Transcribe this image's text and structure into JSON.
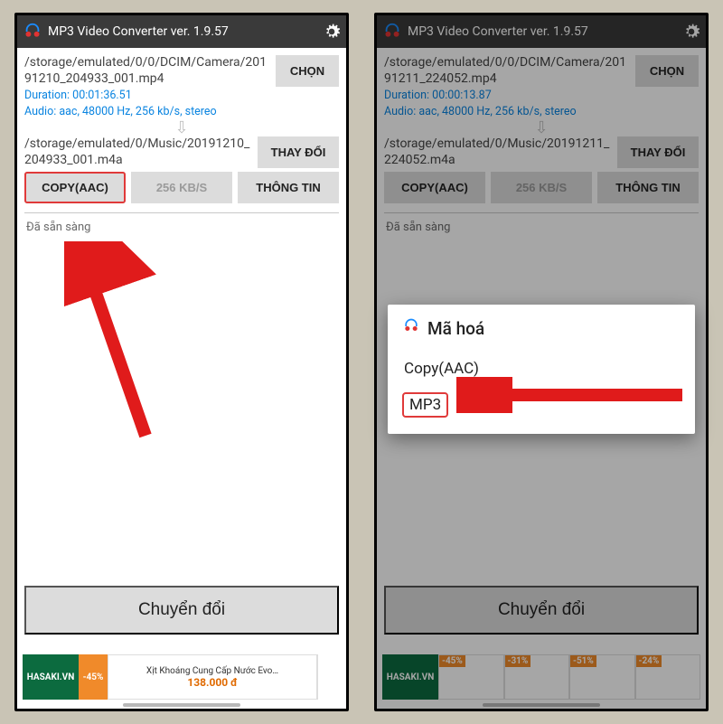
{
  "app": {
    "title": "MP3 Video Converter ver. 1.9.57"
  },
  "left": {
    "source_path": "/storage/emulated/0/0/DCIM/Camera/20191210_204933_001.mp4",
    "duration_line": "Duration: 00:01:36.51",
    "audio_line": "Audio: aac, 48000 Hz, 256 kb/s, stereo",
    "dest_path": "/storage/emulated/0/Music/20191210_204933_001.m4a",
    "btn_choose": "CHỌN",
    "btn_change": "THAY ĐỔI",
    "btn_codec": "COPY(AAC)",
    "btn_bitrate": "256 KB/S",
    "btn_info": "THÔNG TIN",
    "status": "Đã sẵn sàng",
    "btn_convert": "Chuyển đổi",
    "ad": {
      "brand": "HASAKI.VN",
      "discount": "-45%",
      "product": "Xịt Khoáng Cung Cấp Nước Evo…",
      "price": "138.000 đ"
    }
  },
  "right": {
    "source_path": "/storage/emulated/0/0/DCIM/Camera/20191211_224052.mp4",
    "duration_line": "Duration: 00:00:13.87",
    "audio_line": "Audio: aac, 48000 Hz, 256 kb/s, stereo",
    "dest_path": "/storage/emulated/0/Music/20191211_224052.m4a",
    "btn_choose": "CHỌN",
    "btn_change": "THAY ĐỔI",
    "btn_codec": "COPY(AAC)",
    "btn_bitrate": "256 KB/S",
    "btn_info": "THÔNG TIN",
    "status": "Đã sẵn sàng",
    "btn_convert": "Chuyển đổi",
    "dialog": {
      "title": "Mã hoá",
      "opt1": "Copy(AAC)",
      "opt2": "MP3"
    },
    "ad": {
      "brand": "HASAKI.VN",
      "d1": "-45%",
      "d2": "-31%",
      "d3": "-51%",
      "d4": "-24%"
    }
  }
}
